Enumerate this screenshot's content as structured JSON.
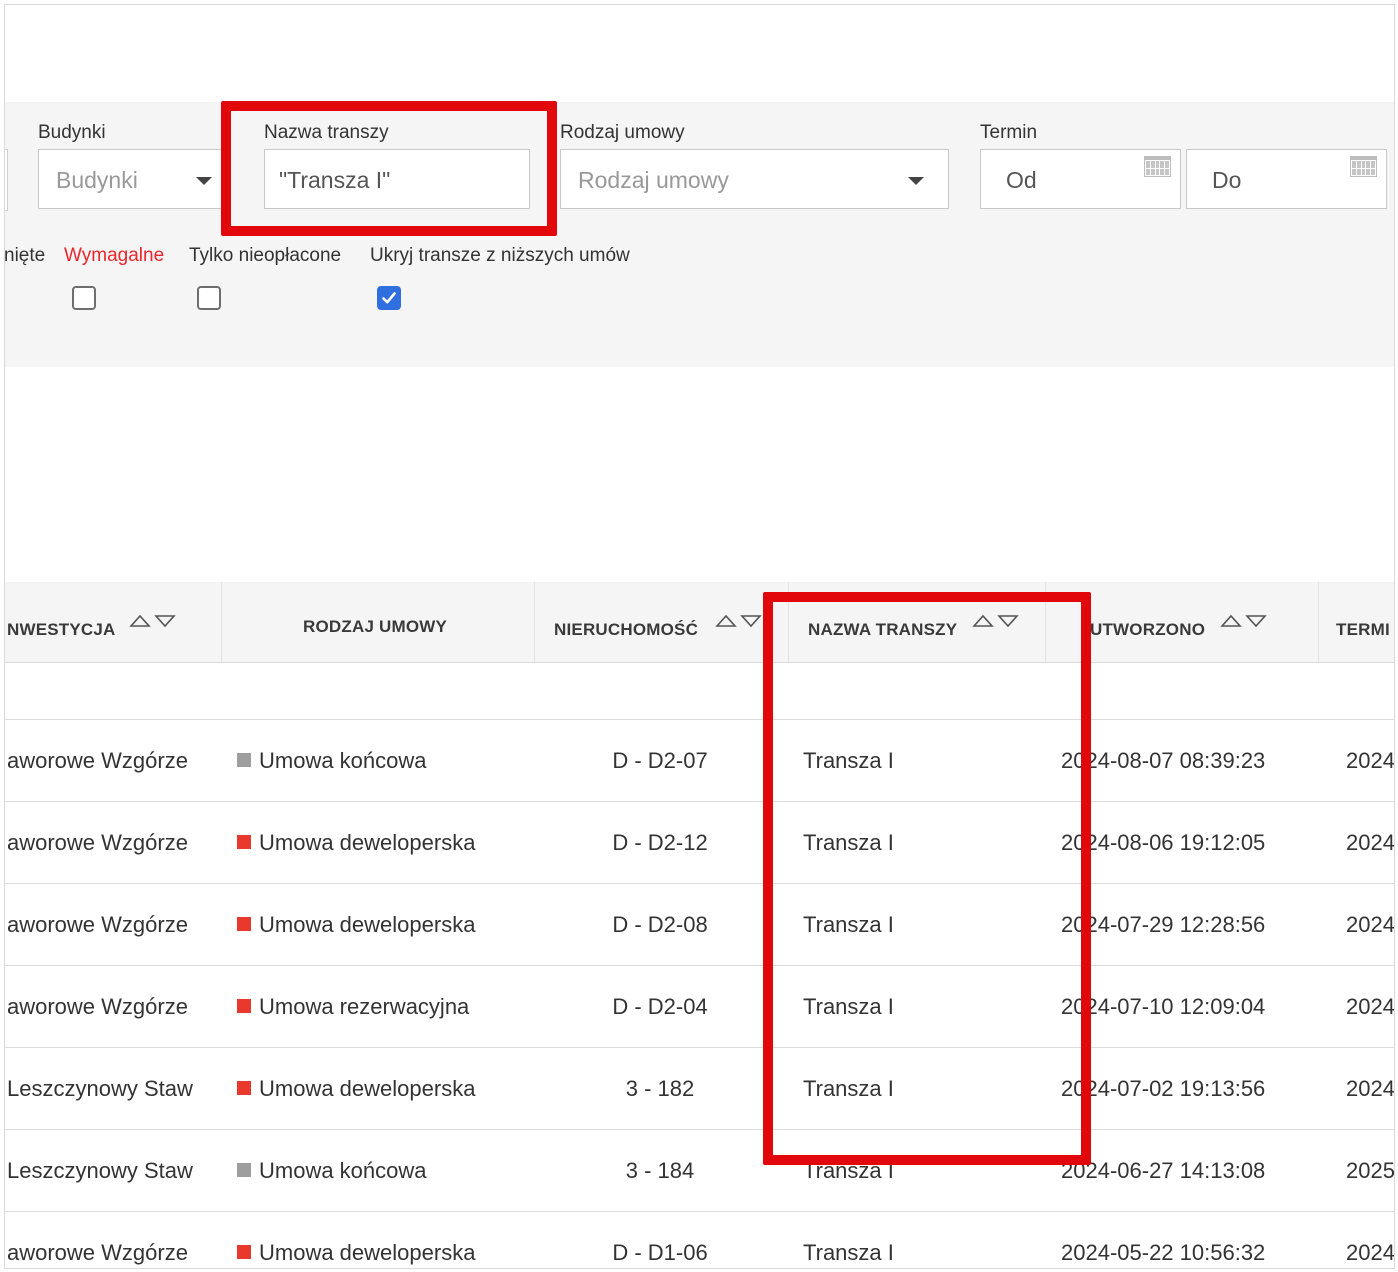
{
  "filters": {
    "buildings": {
      "label": "Budynki",
      "placeholder": "Budynki"
    },
    "tranche_name": {
      "label": "Nazwa transzy",
      "value": "\"Transza I\""
    },
    "contract_type": {
      "label": "Rodzaj umowy",
      "placeholder": "Rodzaj umowy"
    },
    "term": {
      "label": "Termin",
      "from_placeholder": "Od",
      "to_placeholder": "Do"
    },
    "checkboxes": [
      {
        "label": "nięte",
        "checked": null
      },
      {
        "label": "Wymagalne",
        "checked": false,
        "color": "#e8262c"
      },
      {
        "label": "Tylko nieopłacone",
        "checked": false
      },
      {
        "label": "Ukryj transze z niższych umów",
        "checked": true
      }
    ]
  },
  "table": {
    "columns": [
      {
        "label": "NWESTYCJA",
        "sortable": true
      },
      {
        "label": "RODZAJ UMOWY",
        "sortable": false
      },
      {
        "label": "NIERUCHOMOŚĆ",
        "sortable": true
      },
      {
        "label": "NAZWA TRANSZY",
        "sortable": true
      },
      {
        "label": "UTWORZONO",
        "sortable": true
      },
      {
        "label": "TERMI",
        "sortable": false
      }
    ],
    "rows": [
      {
        "investment": "aworowe Wzgórze",
        "type": "Umowa końcowa",
        "type_color": "#9e9e9e",
        "property": "D - D2-07",
        "tranche": "Transza I",
        "created": "2024-08-07 08:39:23",
        "term": "2024"
      },
      {
        "investment": "aworowe Wzgórze",
        "type": "Umowa deweloperska",
        "type_color": "#e8392c",
        "property": "D - D2-12",
        "tranche": "Transza I",
        "created": "2024-08-06 19:12:05",
        "term": "2024"
      },
      {
        "investment": "aworowe Wzgórze",
        "type": "Umowa deweloperska",
        "type_color": "#e8392c",
        "property": "D - D2-08",
        "tranche": "Transza I",
        "created": "2024-07-29 12:28:56",
        "term": "2024"
      },
      {
        "investment": "aworowe Wzgórze",
        "type": "Umowa rezerwacyjna",
        "type_color": "#e8392c",
        "property": "D - D2-04",
        "tranche": "Transza I",
        "created": "2024-07-10 12:09:04",
        "term": "2024"
      },
      {
        "investment": "Leszczynowy Staw",
        "type": "Umowa deweloperska",
        "type_color": "#e8392c",
        "property": "3 - 182",
        "tranche": "Transza I",
        "created": "2024-07-02 19:13:56",
        "term": "2024"
      },
      {
        "investment": "Leszczynowy Staw",
        "type": "Umowa końcowa",
        "type_color": "#9e9e9e",
        "property": "3 - 184",
        "tranche": "Transza I",
        "created": "2024-06-27 14:13:08",
        "term": "2025"
      },
      {
        "investment": "aworowe Wzgórze",
        "type": "Umowa deweloperska",
        "type_color": "#e8392c",
        "property": "D - D1-06",
        "tranche": "Transza I",
        "created": "2024-05-22 10:56:32",
        "term": "2024"
      }
    ]
  },
  "colors": {
    "highlight": "#e1070b",
    "checkbox_checked": "#2f6fe0",
    "panel_bg": "#f5f5f5"
  }
}
